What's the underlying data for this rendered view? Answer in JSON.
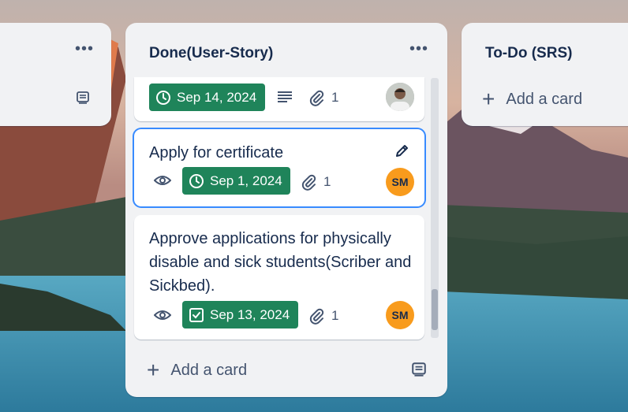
{
  "colors": {
    "list_bg": "#f1f2f4",
    "badge_green": "#1f845a",
    "avatar_orange": "#f89b1d",
    "focus_blue": "#388bff",
    "text_dark": "#172b4d"
  },
  "left_list": {
    "menu_icon": "more-horizontal-icon",
    "template_icon": "card-template-icon"
  },
  "middle_list": {
    "title": "Done(User-Story)",
    "menu_icon": "more-horizontal-icon",
    "cards": [
      {
        "title": "",
        "date": "Sep 14, 2024",
        "date_icon": "clock-icon",
        "has_description": true,
        "attachments": "1",
        "avatar": "user-photo"
      },
      {
        "title": "Apply for certificate",
        "watching": true,
        "date": "Sep 1, 2024",
        "date_icon": "clock-icon",
        "attachments": "1",
        "avatar_initials": "SM",
        "edit_icon": "pencil-icon"
      },
      {
        "title": "Approve applications for physically disable and sick students(Scriber and Sickbed).",
        "watching": true,
        "date": "Sep 13, 2024",
        "date_icon": "checkbox-icon",
        "attachments": "1",
        "avatar_initials": "SM"
      }
    ],
    "add_card_label": "Add a card",
    "template_icon": "card-template-icon"
  },
  "right_list": {
    "title": "To-Do (SRS)",
    "add_card_label": "Add a card"
  }
}
